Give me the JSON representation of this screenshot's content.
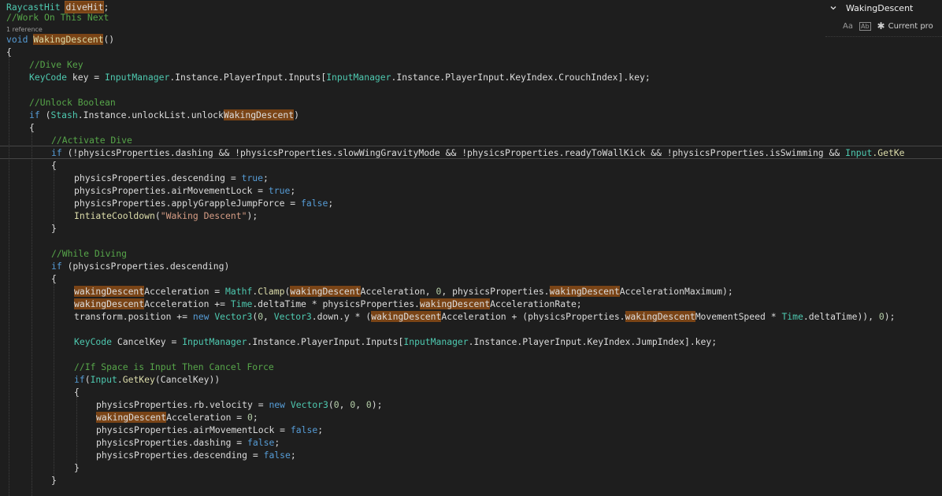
{
  "find_panel": {
    "search_text": "WakingDescent",
    "match_case_label": "Aa",
    "whole_word_label": "Ab",
    "scope_label": "Current pro"
  },
  "codelens": {
    "references": "1 reference"
  },
  "code": {
    "l0": {
      "a": "RaycastHit",
      "b": " ",
      "c": "diveHit",
      "d": ";"
    },
    "l1": "//Work On This Next",
    "l2": {
      "a": "void",
      "b": " ",
      "c": "WakingDescent",
      "d": "()"
    },
    "l3": "{",
    "l4": "//Dive Key",
    "l5": {
      "a": "KeyCode",
      "b": " key = ",
      "c": "InputManager",
      "d": ".Instance.PlayerInput.Inputs[",
      "e": "InputManager",
      "f": ".Instance.PlayerInput.KeyIndex.CrouchIndex].key;"
    },
    "l6": "//Unlock Boolean",
    "l7": {
      "a": "if",
      "b": " (",
      "c": "Stash",
      "d": ".Instance.unlockList.unlock",
      "e": "WakingDescent",
      "f": ")"
    },
    "l8": "{",
    "l9": "//Activate Dive",
    "l10": {
      "a": "if",
      "b": " (!physicsProperties.dashing && !physicsProperties.slowWingGravityMode && !physicsProperties.readyToWallKick && !physicsProperties.isSwimming && ",
      "c": "Input",
      "d": ".GetKe"
    },
    "l11": "{",
    "l12": {
      "a": "physicsProperties.descending = ",
      "b": "true",
      "c": ";"
    },
    "l13": {
      "a": "physicsProperties.airMovementLock = ",
      "b": "true",
      "c": ";"
    },
    "l14": {
      "a": "physicsProperties.applyGrappleJumpForce = ",
      "b": "false",
      "c": ";"
    },
    "l15": {
      "a": "IntiateCooldown",
      "b": "(",
      "c": "\"Waking Descent\"",
      "d": ");"
    },
    "l16": "}",
    "l17": "//While Diving",
    "l18": {
      "a": "if",
      "b": " (physicsProperties.descending)"
    },
    "l19": "{",
    "l20": {
      "a": "wakingDescent",
      "b": "Acceleration = ",
      "c": "Mathf",
      "d": ".",
      "e": "Clamp",
      "f": "(",
      "g": "wakingDescent",
      "h": "Acceleration, ",
      "i": "0",
      "j": ", physicsProperties.",
      "k": "wakingDescent",
      "l": "AccelerationMaximum);"
    },
    "l21": {
      "a": "wakingDescent",
      "b": "Acceleration += ",
      "c": "Time",
      "d": ".deltaTime * physicsProperties.",
      "e": "wakingDescent",
      "f": "AccelerationRate;"
    },
    "l22": {
      "a": "transform.position += ",
      "b": "new",
      "c": " ",
      "d": "Vector3",
      "e": "(",
      "f": "0",
      "g": ", ",
      "h": "Vector3",
      "i": ".down.y * (",
      "j": "wakingDescent",
      "k": "Acceleration + (physicsProperties.",
      "l": "wakingDescent",
      "m": "MovementSpeed * ",
      "n": "Time",
      "o": ".deltaTime)), ",
      "p": "0",
      "q": ");"
    },
    "l23": {
      "a": "KeyCode",
      "b": " ",
      "c": "CancelKey",
      "d": " = ",
      "e": "InputManager",
      "f": ".Instance.PlayerInput.Inputs[",
      "g": "InputManager",
      "h": ".Instance.PlayerInput.KeyIndex.JumpIndex].key;"
    },
    "l24": "//If Space is Input Then Cancel Force",
    "l25": {
      "a": "if",
      "b": "(",
      "c": "Input",
      "d": ".",
      "e": "GetKey",
      "f": "(",
      "g": "CancelKey",
      "h": "))"
    },
    "l26": "{",
    "l27": {
      "a": "physicsProperties.rb.velocity = ",
      "b": "new",
      "c": " ",
      "d": "Vector3",
      "e": "(",
      "f": "0",
      "g": ", ",
      "h": "0",
      "i": ", ",
      "j": "0",
      "k": ");"
    },
    "l28": {
      "a": "wakingDescent",
      "b": "Acceleration = ",
      "c": "0",
      "d": ";"
    },
    "l29": {
      "a": "physicsProperties.airMovementLock = ",
      "b": "false",
      "c": ";"
    },
    "l30": {
      "a": "physicsProperties.dashing = ",
      "b": "false",
      "c": ";"
    },
    "l31": {
      "a": "physicsProperties.descending = ",
      "b": "false",
      "c": ";"
    },
    "l32": "}",
    "l33": "}"
  }
}
